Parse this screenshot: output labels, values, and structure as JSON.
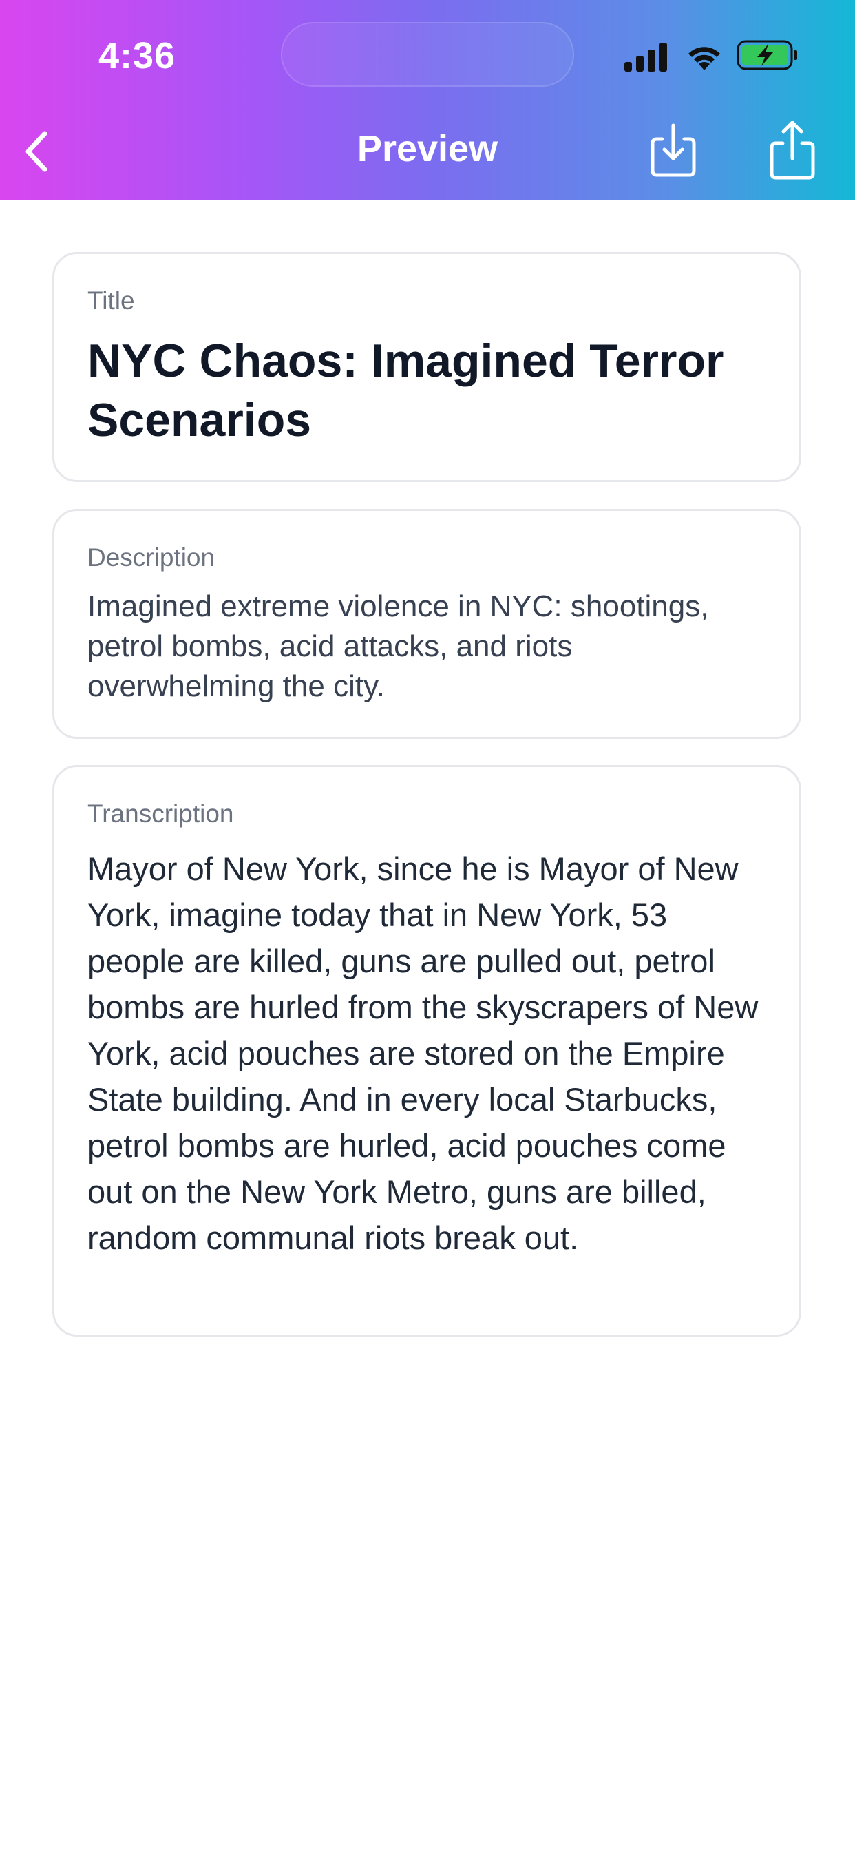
{
  "status_bar": {
    "time": "4:36",
    "icons": [
      "signal-icon",
      "wifi-icon",
      "battery-charging-icon"
    ]
  },
  "header": {
    "title": "Preview",
    "back_icon": "chevron-left-icon",
    "download_icon": "download-icon",
    "share_icon": "share-icon"
  },
  "cards": {
    "title": {
      "label": "Title",
      "value": "NYC Chaos: Imagined Terror Scenarios"
    },
    "description": {
      "label": "Description",
      "value": "Imagined extreme violence in NYC: shootings, petrol bombs, acid attacks, and riots overwhelming the city."
    },
    "transcription": {
      "label": "Transcription",
      "value": "Mayor of New York, since he is Mayor of New York, imagine today that in New York, 53 people are killed, guns are pulled out, petrol bombs are hurled from the skyscrapers of New York, acid pouches are stored on the Empire State building. And in every local Starbucks, petrol bombs are hurled, acid pouches come out on the New York Metro, guns are billed, random communal riots break out."
    }
  },
  "colors": {
    "header_gradient_start": "#d946ef",
    "header_gradient_mid": "#7c6cf0",
    "header_gradient_end": "#14b8d6",
    "battery_fill": "#34c759",
    "card_border": "#e5e7eb"
  }
}
